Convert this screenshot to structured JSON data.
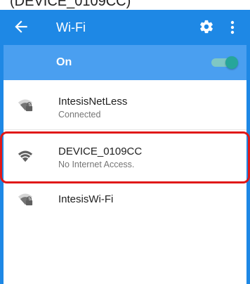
{
  "caption": {
    "text": "(DEVICE_0109CC)"
  },
  "appbar": {
    "title": "Wi-Fi",
    "back_icon": "arrow-left-icon",
    "settings_icon": "gear-icon",
    "more_icon": "more-vert-icon",
    "color": "#1e88e5"
  },
  "toggle": {
    "label": "On",
    "state": "on",
    "accent": "#26a69a"
  },
  "networks": [
    {
      "name": "IntesisNetLess",
      "status": "Connected",
      "icon": "wifi-locked-icon"
    },
    {
      "name": "DEVICE_0109CC",
      "status": "No Internet Access.",
      "icon": "wifi-open-icon"
    },
    {
      "name": "IntesisWi-Fi",
      "status": "",
      "icon": "wifi-locked-icon"
    }
  ],
  "highlight": {
    "color": "#e01818"
  }
}
